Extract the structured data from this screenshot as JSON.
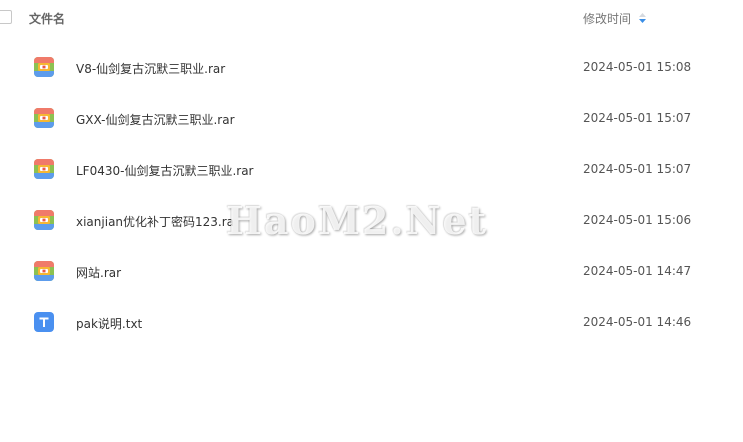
{
  "header": {
    "name_label": "文件名",
    "time_label": "修改时间",
    "sort_icon": "sort-icon"
  },
  "files": [
    {
      "name": "V8-仙剑复古沉默三职业.rar",
      "time": "2024-05-01 15:08",
      "icon": "archive-icon"
    },
    {
      "name": "GXX-仙剑复古沉默三职业.rar",
      "time": "2024-05-01 15:07",
      "icon": "archive-icon"
    },
    {
      "name": "LF0430-仙剑复古沉默三职业.rar",
      "time": "2024-05-01 15:07",
      "icon": "archive-icon"
    },
    {
      "name": "xianjian优化补丁密码123.ra",
      "time": "2024-05-01 15:06",
      "icon": "archive-icon"
    },
    {
      "name": "网站.rar",
      "time": "2024-05-01 14:47",
      "icon": "archive-icon"
    },
    {
      "name": "pak说明.txt",
      "time": "2024-05-01 14:46",
      "icon": "text-file-icon"
    }
  ],
  "watermark": {
    "text": "HaoM2.Net"
  },
  "colors": {
    "archive_top": "#f07a6a",
    "archive_mid": "#8cc152",
    "archive_bottom": "#5d9cec",
    "text_file": "#4a90f0"
  }
}
